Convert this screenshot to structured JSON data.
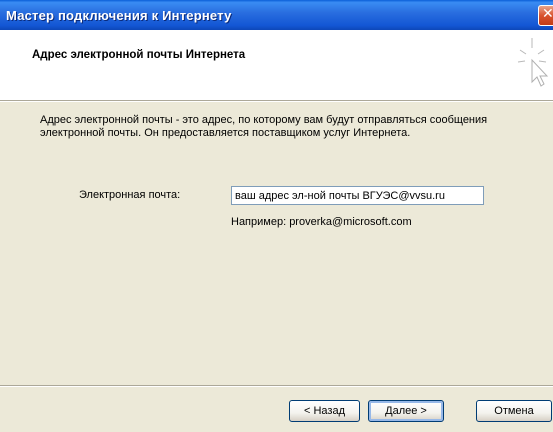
{
  "window": {
    "title": "Мастер подключения к Интернету",
    "close_glyph": "✕"
  },
  "header": {
    "heading": "Адрес электронной почты Интернета",
    "icon": "wizard-cursor-icon"
  },
  "body": {
    "description": "Адрес электронной почты - это адрес, по которому вам будут отправляться сообщения электронной почты. Он предоставляется поставщиком услуг Интернета.",
    "email_label": "Электронная почта:",
    "email_value": "ваш адрес эл-ной почты ВГУЭС@vvsu.ru",
    "example": "Например: proverka@microsoft.com"
  },
  "footer": {
    "back_label": "< Назад",
    "next_label": "Далее >",
    "cancel_label": "Отмена"
  },
  "colors": {
    "titlebar": "#2a6fe0",
    "dialog_bg": "#ece9d8",
    "header_bg": "#ffffff"
  }
}
